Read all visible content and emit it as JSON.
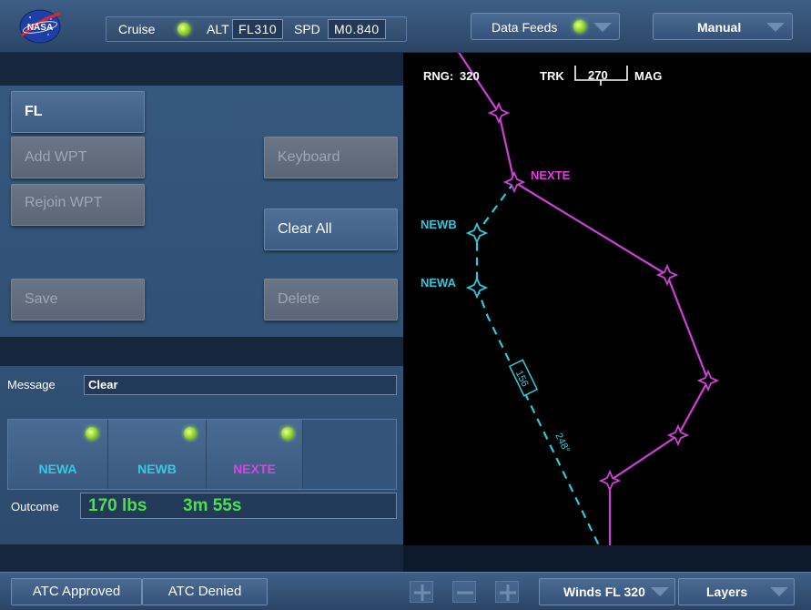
{
  "header": {
    "logo_text": "NASA",
    "mode_label": "Cruise",
    "alt_label": "ALT",
    "alt_value": "FL310",
    "spd_label": "SPD",
    "spd_value": "M0.840",
    "data_feeds_label": "Data Feeds",
    "manual_label": "Manual"
  },
  "left_panel": {
    "fl_button": "FL",
    "add_wpt": "Add WPT",
    "rejoin_wpt": "Rejoin WPT",
    "keyboard": "Keyboard",
    "clear_all": "Clear All",
    "save": "Save",
    "delete": "Delete",
    "message_label": "Message",
    "message_value": "Clear",
    "waypoint_cards": [
      {
        "label": "NEWA",
        "color": "#38c8e0"
      },
      {
        "label": "NEWB",
        "color": "#38c8e0"
      },
      {
        "label": "NEXTE",
        "color": "#e040e0"
      }
    ],
    "outcome_label": "Outcome",
    "outcome_fuel": "170 lbs",
    "outcome_time": "3m 55s"
  },
  "map": {
    "rng_label": "RNG:",
    "rng_value": "320",
    "trk_label": "TRK",
    "trk_value": "270",
    "mag_label": "MAG",
    "waypoints": {
      "nexte": "NEXTE",
      "newb": "NEWB",
      "newa": "NEWA"
    },
    "segment_distance": "156",
    "segment_heading": "248°",
    "colors": {
      "active_route": "#d040d8",
      "proposed_route": "#30c8dc"
    }
  },
  "bottom": {
    "atc_approved": "ATC Approved",
    "atc_denied": "ATC Denied",
    "winds": "Winds FL 320",
    "layers": "Layers"
  }
}
